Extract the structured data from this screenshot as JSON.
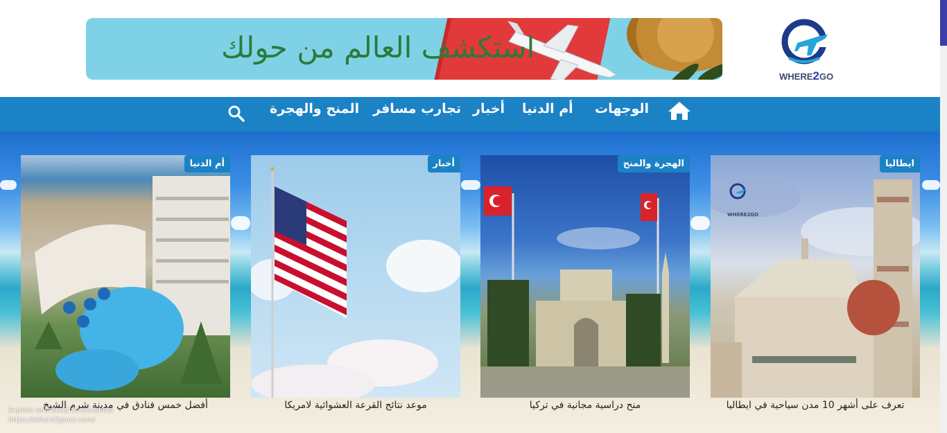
{
  "header": {
    "banner_text": "استكشف العالم من حولك",
    "logo": {
      "text_before": "WHERE",
      "text_number": "2",
      "text_after": "GO",
      "icon": "globe-plane-icon"
    }
  },
  "nav": {
    "items": [
      {
        "label": "الوجهات"
      },
      {
        "label": "أم الدنيا"
      },
      {
        "label": "أخبار"
      },
      {
        "label": "تجارب مسافر"
      },
      {
        "label": "المنح والهجرة"
      }
    ],
    "home_icon": "home-icon",
    "search_icon": "search-icon"
  },
  "cards": [
    {
      "badge": "ايطاليا",
      "title": "تعرف على أشهر 10 مدن سياحية في ايطاليا",
      "watermark_logo": "WHERE2GO"
    },
    {
      "badge": "الهجرة والمنح",
      "title": "منح دراسية مجانية في تركيا"
    },
    {
      "badge": "أخبار",
      "title": "موعد نتائج القرعة العشوائية لامريكا"
    },
    {
      "badge": "أم الدنيا",
      "title": "أفضل خمس فنادق في مدينة شرم الشيخ"
    }
  ],
  "overlay": {
    "line1": "Explain and Send Screenshots",
    "line2": "https://where2gooo.com/"
  },
  "colors": {
    "nav_bg": "#1b82c6",
    "badge_bg": "#1b82c6",
    "accent": "#3b3ea8"
  }
}
